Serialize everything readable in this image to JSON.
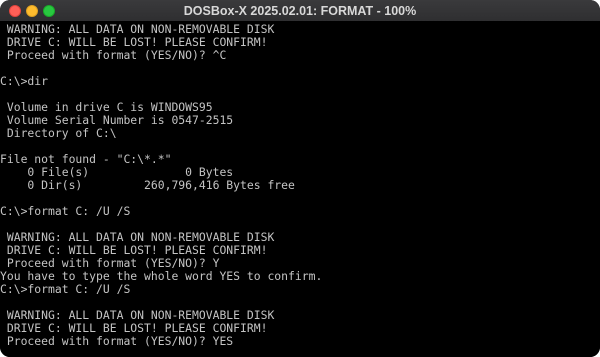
{
  "window": {
    "title": "DOSBox-X 2025.02.01: FORMAT - 100%",
    "colors": {
      "close": "#ff5f57",
      "minimize": "#febc2e",
      "zoom": "#28c840",
      "terminal_bg": "#000000",
      "terminal_fg": "#c4c4c4"
    }
  },
  "console": {
    "lines": [
      " WARNING: ALL DATA ON NON-REMOVABLE DISK",
      " DRIVE C: WILL BE LOST! PLEASE CONFIRM!",
      " Proceed with format (YES/NO)? ^C",
      "",
      "C:\\>dir",
      "",
      " Volume in drive C is WINDOWS95",
      " Volume Serial Number is 0547-2515",
      " Directory of C:\\",
      "",
      "File not found - \"C:\\*.*\"",
      "    0 File(s)              0 Bytes",
      "    0 Dir(s)         260,796,416 Bytes free",
      "",
      "C:\\>format C: /U /S",
      "",
      " WARNING: ALL DATA ON NON-REMOVABLE DISK",
      " DRIVE C: WILL BE LOST! PLEASE CONFIRM!",
      " Proceed with format (YES/NO)? Y",
      "You have to type the whole word YES to confirm.",
      "C:\\>format C: /U /S",
      "",
      " WARNING: ALL DATA ON NON-REMOVABLE DISK",
      " DRIVE C: WILL BE LOST! PLEASE CONFIRM!",
      " Proceed with format (YES/NO)? YES"
    ]
  }
}
